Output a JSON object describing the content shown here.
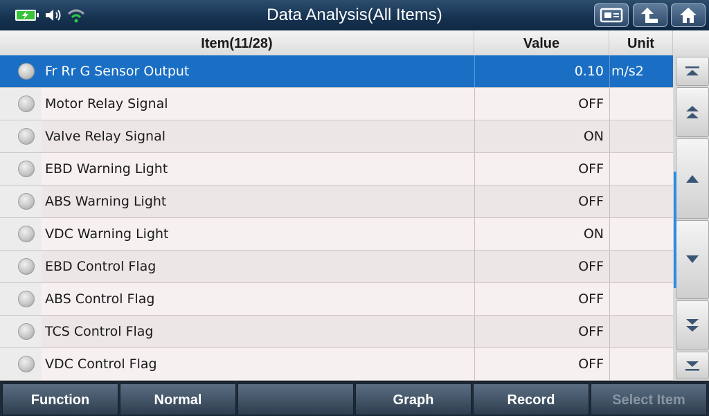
{
  "header": {
    "title": "Data Analysis(All Items)",
    "status_icons": [
      "battery-charging-icon",
      "speaker-icon",
      "wifi-icon"
    ],
    "buttons": [
      "screenshot-icon",
      "back-icon",
      "home-icon"
    ]
  },
  "table": {
    "columns": {
      "item": "Item(11/28)",
      "value": "Value",
      "unit": "Unit"
    },
    "rows": [
      {
        "name": "Fr Rr G Sensor Output",
        "value": "0.10",
        "unit": "m/s2",
        "selected": true
      },
      {
        "name": "Motor Relay Signal",
        "value": "OFF",
        "unit": ""
      },
      {
        "name": "Valve Relay Signal",
        "value": "ON",
        "unit": ""
      },
      {
        "name": "EBD Warning Light",
        "value": "OFF",
        "unit": ""
      },
      {
        "name": "ABS Warning Light",
        "value": "OFF",
        "unit": ""
      },
      {
        "name": "VDC Warning Light",
        "value": "ON",
        "unit": ""
      },
      {
        "name": "EBD Control Flag",
        "value": "OFF",
        "unit": ""
      },
      {
        "name": "ABS Control Flag",
        "value": "OFF",
        "unit": ""
      },
      {
        "name": "TCS Control Flag",
        "value": "OFF",
        "unit": ""
      },
      {
        "name": "VDC Control Flag",
        "value": "OFF",
        "unit": ""
      }
    ]
  },
  "scroll": {
    "buttons": [
      "scroll-top-icon",
      "page-up-icon",
      "line-up-icon",
      "line-down-icon",
      "page-down-icon",
      "scroll-bottom-icon"
    ]
  },
  "footer": {
    "function": "Function",
    "normal": "Normal",
    "blank": "",
    "graph": "Graph",
    "record": "Record",
    "select_item": "Select Item"
  },
  "colors": {
    "selected_row": "#1a6fc4",
    "scroll_indicator": "#2a8de0",
    "battery": "#39c23a",
    "wifi": "#2ecc40"
  }
}
